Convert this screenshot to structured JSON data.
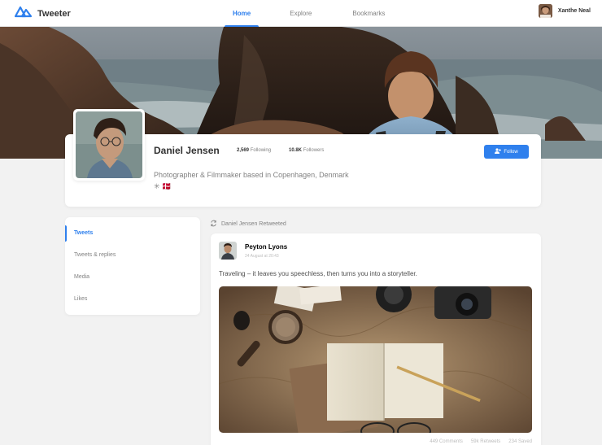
{
  "brand": {
    "name": "Tweeter",
    "color": "#2f80ed"
  },
  "nav": {
    "items": [
      {
        "label": "Home",
        "active": true
      },
      {
        "label": "Explore",
        "active": false
      },
      {
        "label": "Bookmarks",
        "active": false
      }
    ]
  },
  "user": {
    "name": "Xanthe Neal"
  },
  "profile": {
    "name": "Daniel Jensen",
    "following_count": "2,569",
    "following_label": "Following",
    "followers_count": "10.8K",
    "followers_label": "Followers",
    "bio": "Photographer & Filmmaker based in Copenhagen, Denmark ✳ 🇩🇰",
    "follow_label": "Follow"
  },
  "filters": {
    "items": [
      {
        "label": "Tweets",
        "active": true
      },
      {
        "label": "Tweets & replies",
        "active": false
      },
      {
        "label": "Media",
        "active": false
      },
      {
        "label": "Likes",
        "active": false
      }
    ]
  },
  "tweet": {
    "retweeted_by": "Daniel Jensen Retweeted",
    "author": "Peyton Lyons",
    "time": "24 August at 20:43",
    "text": "Traveling – it leaves you speechless, then turns you into a storyteller.",
    "comments": "449 Comments",
    "retweets": "59k Retweets",
    "saved": "234 Saved"
  },
  "icons": {
    "logo": "tweeter-logo-icon",
    "follow": "user-plus-icon",
    "retweet": "retweet-icon"
  },
  "colors": {
    "accent": "#2f80ed",
    "background": "#f2f2f2"
  }
}
